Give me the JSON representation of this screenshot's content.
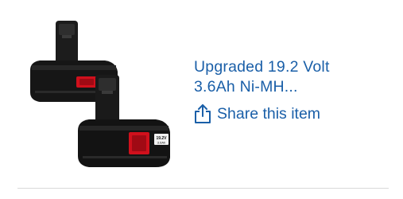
{
  "product": {
    "title_line1": "Upgraded 19.2 Volt",
    "title_line2": "3.6Ah Ni-MH...",
    "image_icon": "battery-pack-image",
    "battery_label_line1": "19.2V",
    "battery_label_line2": "3.6Ah"
  },
  "share": {
    "label": "Share this item",
    "icon": "share-icon"
  },
  "colors": {
    "link": "#1a5fa8",
    "battery_body": "#141414",
    "battery_accent": "#d0101c",
    "divider": "#d9d9d9"
  }
}
